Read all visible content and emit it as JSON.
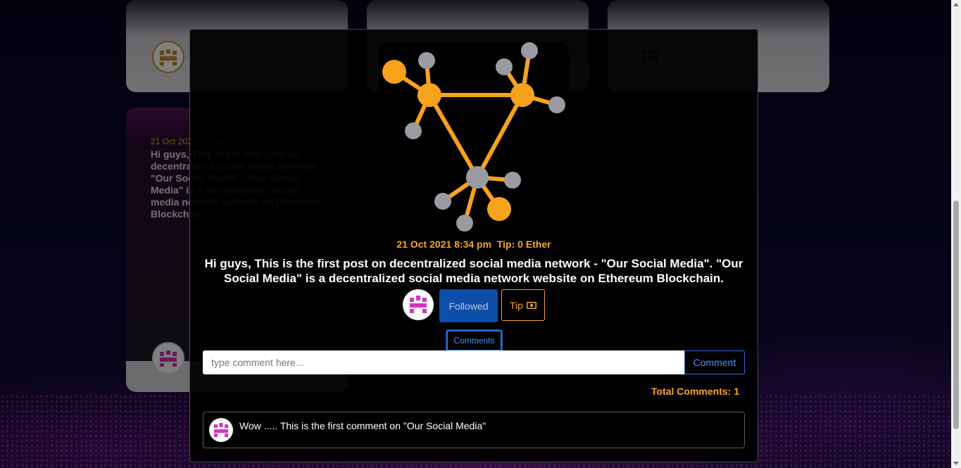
{
  "background_cards": [
    {
      "date": "21 Oct 2021 8:34 pm",
      "text": "Hi guys, This is the first post on decentralized social media network - \"Our Social Media\". \"Our Social Media\" is a decentralized social media network website on Ethereum Blockchain."
    }
  ],
  "modal": {
    "post": {
      "date": "21 Oct 2021 8:34 pm",
      "tip_label": "Tip: 0 Ether",
      "text": "Hi guys, This is the first post on decentralized social media network - \"Our Social Media\". \"Our Social Media\" is a decentralized social media network website on Ethereum Blockchain."
    },
    "actions": {
      "follow_label": "Followed",
      "tip_label": "Tip",
      "tip_icon": "cash-icon"
    },
    "comments": {
      "toggle_label": "Comments",
      "input_placeholder": "type comment here...",
      "submit_label": "Comment",
      "total_label": "Total Comments: 1",
      "items": [
        {
          "text": "Wow ..... This is the first comment on \"Our Social Media\""
        }
      ]
    }
  },
  "colors": {
    "accent": "#f5a623",
    "primary_button": "#0d4ea8",
    "link_blue": "#4d8fff",
    "avatar_pink": "#d633c2"
  }
}
